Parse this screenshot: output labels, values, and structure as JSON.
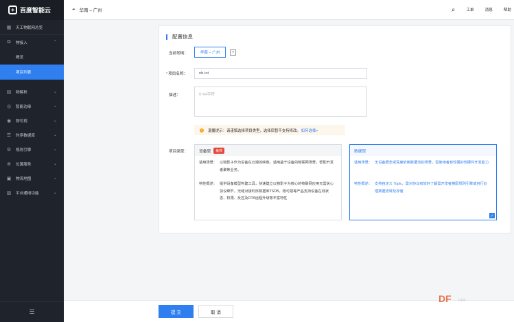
{
  "app": {
    "logo_text": "百度智能云"
  },
  "sidebar": {
    "top_item": "天工物联网总览",
    "items": [
      {
        "label": "物接入",
        "expanded": true,
        "icon": "connect-icon"
      },
      {
        "label": "概览",
        "sub": true
      },
      {
        "label": "项目列表",
        "sub": true,
        "active": true
      },
      {
        "label": "物解析",
        "icon": "parse-icon"
      },
      {
        "label": "智能边缘",
        "icon": "edge-icon"
      },
      {
        "label": "物可视",
        "icon": "eye-icon"
      },
      {
        "label": "时序数据库",
        "icon": "database-icon"
      },
      {
        "label": "规则引擎",
        "icon": "rule-icon"
      },
      {
        "label": "位置服务",
        "icon": "location-icon"
      },
      {
        "label": "物流地图",
        "icon": "map-icon"
      },
      {
        "label": "平台通用功能",
        "icon": "platform-icon"
      }
    ]
  },
  "topbar": {
    "region": "华南 – 广州",
    "links": [
      "工单",
      "消息",
      "帮助"
    ]
  },
  "form": {
    "title": "配置信息",
    "region_label": "当前地域：",
    "region_value": "华南 – 广州",
    "help_mark": "?",
    "name_label": "项目名称：",
    "name_value": "nb-iot",
    "desc_label": "描述：",
    "desc_placeholder": "0~64字符",
    "tip_text": "温馨提示：请谨慎选择项目类型，选择后暂不支持修改。",
    "tip_link": "如何选择>",
    "type_label": "项目类型：",
    "device_type": {
      "title": "设备型",
      "badge": "推荐",
      "scene_key": "适用场景：",
      "scene_value": "以物影子作为设备在云端的映像，适用基于设备的物联网场景，帮助开发者聚焦业务。",
      "feature_key": "特性概述：",
      "feature_value": "提供设备模型构建工具，快速建立以物影子为核心的物联网应用无需关心协议细节，无缝对接时序数据库TSDB，物可视等产品支持设备在线状态、权限、反控及OTA远程升级等丰富特性"
    },
    "data_type": {
      "title": "数据型",
      "scene_key": "适用场景：",
      "scene_value": "无设备概念或深度依赖数据流的场景，需使用者有较强的软硬件开发能力",
      "feature_key": "特性概述：",
      "feature_value": "支持自定义 Topic，需对协议有较好了解需开发者搭配规则引擎或自行处理数据流转及存储",
      "selected": true
    }
  },
  "footer": {
    "submit": "提 交",
    "cancel": "取 消"
  },
  "watermark": {
    "brand": "DF",
    "suffix": "RDB"
  }
}
